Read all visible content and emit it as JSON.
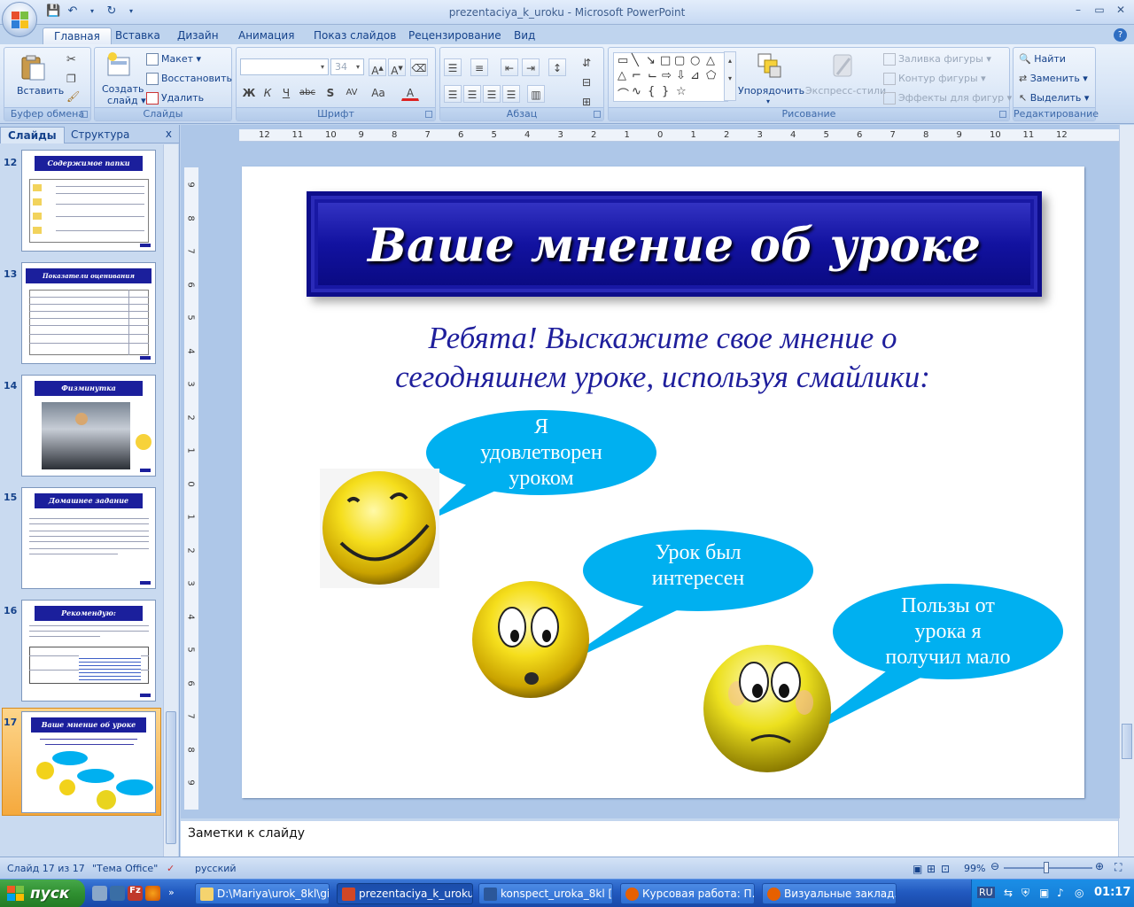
{
  "window": {
    "title": "prezentaciya_k_uroku - Microsoft PowerPoint",
    "controls": [
      "–",
      "▭",
      "✕"
    ]
  },
  "ribbon": {
    "tabs": [
      "Главная",
      "Вставка",
      "Дизайн",
      "Анимация",
      "Показ слайдов",
      "Рецензирование",
      "Вид"
    ],
    "active_tab": "Главная",
    "clipboard": {
      "label": "Буфер обмена",
      "paste": "Вставить"
    },
    "slides": {
      "label": "Слайды",
      "new_slide_1": "Создать",
      "new_slide_2": "слайд",
      "layout": "Макет",
      "reset": "Восстановить",
      "delete": "Удалить"
    },
    "font": {
      "label": "Шрифт",
      "font_name": "",
      "font_size": "34",
      "bold": "Ж",
      "italic": "К",
      "underline": "Ч",
      "strike": "abc",
      "shadow": "S",
      "spacing": "AV",
      "case": "Aa",
      "color": "A"
    },
    "paragraph": {
      "label": "Абзац"
    },
    "drawing": {
      "label": "Рисование",
      "arrange": "Упорядочить",
      "quick_styles": "Экспресс-стили",
      "fill": "Заливка фигуры",
      "outline": "Контур фигуры",
      "effects": "Эффекты для фигур"
    },
    "editing": {
      "label": "Редактирование",
      "find": "Найти",
      "replace": "Заменить",
      "select": "Выделить"
    }
  },
  "left_pane": {
    "tabs": [
      "Слайды",
      "Структура"
    ],
    "close": "x",
    "thumbnails": [
      {
        "num": "12",
        "title": "Содержимое папки портфолио:"
      },
      {
        "num": "13",
        "title": "Показатели оценивания презентации"
      },
      {
        "num": "14",
        "title": "Физминутка"
      },
      {
        "num": "15",
        "title": "Домашнее задание"
      },
      {
        "num": "16",
        "title": "Рекомендую:"
      },
      {
        "num": "17",
        "title": "Ваше мнение об уроке"
      }
    ]
  },
  "ruler": {
    "top": [
      "12",
      "11",
      "10",
      "9",
      "8",
      "7",
      "6",
      "5",
      "4",
      "3",
      "2",
      "1",
      "0",
      "1",
      "2",
      "3",
      "4",
      "5",
      "6",
      "7",
      "8",
      "9",
      "10",
      "11",
      "12"
    ],
    "left": [
      "9",
      "8",
      "7",
      "6",
      "5",
      "4",
      "3",
      "2",
      "1",
      "0",
      "1",
      "2",
      "3",
      "4",
      "5",
      "6",
      "7",
      "8",
      "9"
    ]
  },
  "slide": {
    "title": "Ваше мнение об уроке",
    "subtitle_line1": "Ребята! Выскажите свое мнение о",
    "subtitle_line2": "сегодняшнем  уроке, используя смайлики:",
    "bubble1": [
      "Я",
      "удовлетворен",
      "уроком"
    ],
    "bubble2": [
      "Урок был",
      "интересен"
    ],
    "bubble3": [
      "Пользы от",
      "урока я",
      "получил мало"
    ],
    "bubble_color": "#00b0f0",
    "title_bg": "#1212a0"
  },
  "notes": {
    "text": "Заметки к слайду"
  },
  "status": {
    "slide_counter": "Слайд 17 из 17",
    "theme": "\"Тема Office\"",
    "language": "русский",
    "zoom": "99%"
  },
  "taskbar": {
    "start": "пуск",
    "tasks": [
      "D:\\Mariya\\urok_8kl\\gi...",
      "prezentaciya_k_uroku",
      "konspect_uroka_8kl [...",
      "Курсовая работа: П...",
      "Визуальные заклад..."
    ],
    "lang": "RU",
    "time": "01:17"
  }
}
